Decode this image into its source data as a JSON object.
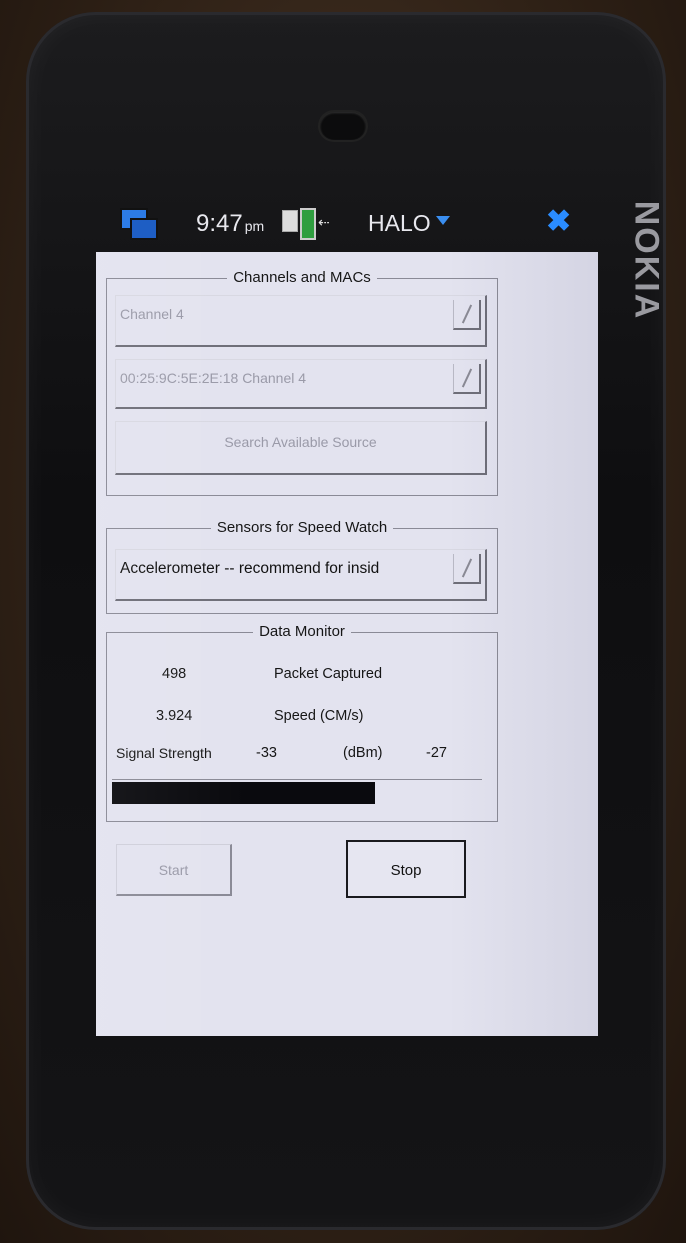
{
  "statusbar": {
    "time": "9:47",
    "ampm": "pm",
    "app_title": "HALO",
    "icons": {
      "task_switcher": "task-switcher-icon",
      "battery": "battery-icon",
      "usb": "usb-icon",
      "dropdown": "chevron-down-icon",
      "close": "close-icon"
    },
    "accent": "#2a8cff"
  },
  "device": {
    "brand": "NOKIA"
  },
  "channels": {
    "legend": "Channels and MACs",
    "channel_select": "Channel 4",
    "source_select": "00:25:9C:5E:2E:18 Channel 4",
    "search_button": "Search Available Source"
  },
  "sensors": {
    "legend": "Sensors for Speed Watch",
    "sensor_select": "Accelerometer -- recommend for insid"
  },
  "monitor": {
    "legend": "Data Monitor",
    "packets_value": "498",
    "packets_label": "Packet Captured",
    "speed_value": "3.924",
    "speed_label": "Speed (CM/s)",
    "signal_label": "Signal Strength",
    "signal_value": "-33",
    "signal_unit": "(dBm)",
    "signal_max": "-27",
    "signal_progress_fraction": 0.71
  },
  "actions": {
    "start_label": "Start",
    "stop_label": "Stop"
  }
}
